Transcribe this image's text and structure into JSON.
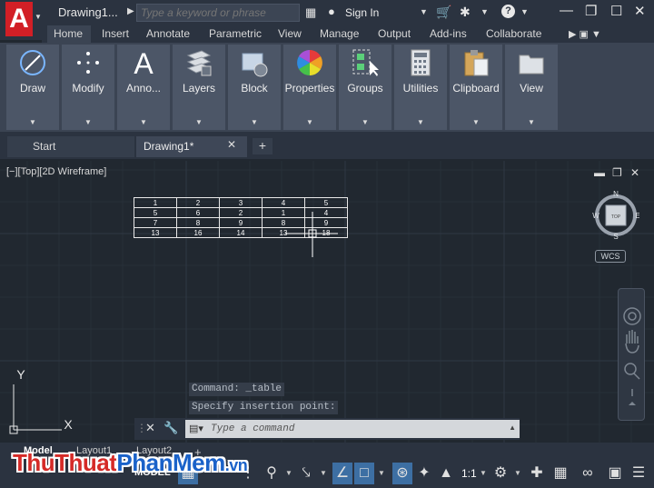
{
  "title_bar": {
    "document_title": "Drawing1...",
    "search_placeholder": "Type a keyword or phrase",
    "sign_in_label": "Sign In"
  },
  "ribbon": {
    "tabs": [
      "Home",
      "Insert",
      "Annotate",
      "Parametric",
      "View",
      "Manage",
      "Output",
      "Add-ins",
      "Collaborate"
    ],
    "active_tab": "Home",
    "panels": [
      "Draw",
      "Modify",
      "Anno...",
      "Layers",
      "Block",
      "Properties",
      "Groups",
      "Utilities",
      "Clipboard",
      "View"
    ]
  },
  "file_tabs": {
    "start_label": "Start",
    "drawing_label": "Drawing1*"
  },
  "viewport": {
    "label": "[−][Top][2D Wireframe]"
  },
  "drawn_table": {
    "rows": [
      [
        "1",
        "2",
        "3",
        "4",
        "5"
      ],
      [
        "5",
        "6",
        "2",
        "1",
        "4"
      ],
      [
        "7",
        "8",
        "9",
        "8",
        "9"
      ],
      [
        "13",
        "16",
        "14",
        "13",
        "18"
      ]
    ]
  },
  "viewcube": {
    "north": "N",
    "south": "S",
    "east": "E",
    "west": "W",
    "face": "TOP",
    "wcs": "WCS"
  },
  "ucs": {
    "y_label": "Y",
    "x_label": "X"
  },
  "command": {
    "history": [
      "Command: _table",
      "Specify insertion point:"
    ],
    "input_placeholder": "Type a command"
  },
  "layout_tabs": [
    "Model",
    "Layout1",
    "Layout2"
  ],
  "status_bar": {
    "model_label": "MODEL",
    "scale": "1:1"
  },
  "watermark": {
    "part1": "Thu",
    "part2": "Thuat",
    "part3": "Phan",
    "part4": "Mem",
    "part5": ".vn"
  },
  "colors": {
    "canvas": "#212830",
    "ribbon": "#3b4453",
    "panel": "#4c5667",
    "logo_red": "#d21f26",
    "status_active": "#3d6fa3"
  }
}
